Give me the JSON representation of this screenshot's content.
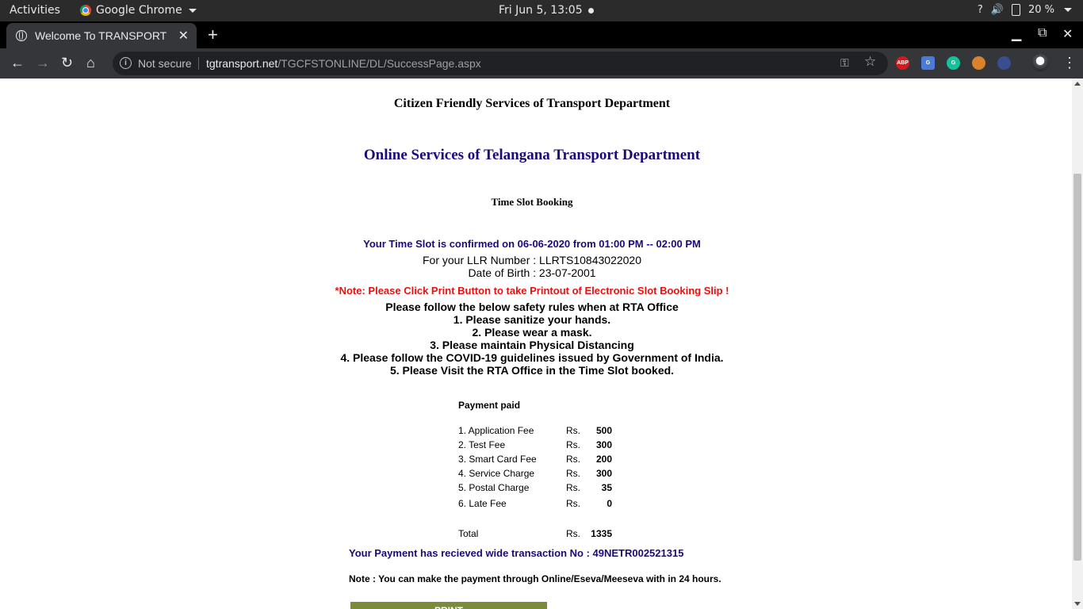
{
  "system_bar": {
    "activities": "Activities",
    "app_name": "Google Chrome",
    "clock": "Fri Jun  5, 13:05",
    "battery": "20 %"
  },
  "browser": {
    "tab_title": "Welcome To TRANSPORT",
    "url_security": "Not secure",
    "url_domain": "tgtransport.net",
    "url_path": "/TGCFSTONLINE/DL/SuccessPage.aspx",
    "extensions": [
      {
        "name": "adblock-plus-icon",
        "label": "ABP",
        "color": "#d4191b"
      },
      {
        "name": "google-translate-icon",
        "label": "G",
        "color": "#4a7bd8"
      },
      {
        "name": "grammarly-icon",
        "label": "G",
        "color": "#15c39a"
      },
      {
        "name": "extension-owl-icon",
        "label": "",
        "color": "#d9822b"
      },
      {
        "name": "extension-cursor-icon",
        "label": "",
        "color": "#3a4d8f"
      }
    ]
  },
  "page": {
    "header_title": "Citizen Friendly Services of Transport Department",
    "main_title": "Online Services of Telangana Transport Department",
    "section_title": "Time Slot Booking",
    "confirmation": "Your Time Slot is confirmed on 06-06-2020 from 01:00 PM -- 02:00 PM",
    "llr_line": "For your LLR Number : LLRTS10843022020",
    "dob_line": "Date of Birth : 23-07-2001",
    "print_note": "*Note: Please Click Print Button to take Printout of Electronic Slot Booking Slip !",
    "safety_rules": [
      "Please follow the below safety rules when at RTA Office",
      "1. Please sanitize your hands.",
      "2. Please wear a mask.",
      "3. Please maintain Physical Distancing",
      "4. Please follow the COVID-19 guidelines issued by Government of India.",
      "5. Please Visit the RTA Office in the Time Slot booked."
    ],
    "payment_heading": "Payment paid",
    "fees": [
      {
        "name": "1. Application Fee",
        "currency": "Rs.",
        "amount": "500"
      },
      {
        "name": "2. Test Fee",
        "currency": "Rs.",
        "amount": "300"
      },
      {
        "name": "3. Smart Card Fee",
        "currency": "Rs.",
        "amount": "200"
      },
      {
        "name": "4. Service Charge",
        "currency": "Rs.",
        "amount": "300"
      },
      {
        "name": "5. Postal Charge",
        "currency": "Rs.",
        "amount": "35"
      },
      {
        "name": "6. Late Fee",
        "currency": "Rs.",
        "amount": "0"
      }
    ],
    "total": {
      "name": "Total",
      "currency": "Rs.",
      "amount": "1335"
    },
    "transaction": "Your Payment has recieved wide transaction No : 49NETR002521315",
    "payment_note": "Note : You can make the payment through Online/Eseva/Meeseva with in 24 hours.",
    "print_button": "PRINT"
  }
}
